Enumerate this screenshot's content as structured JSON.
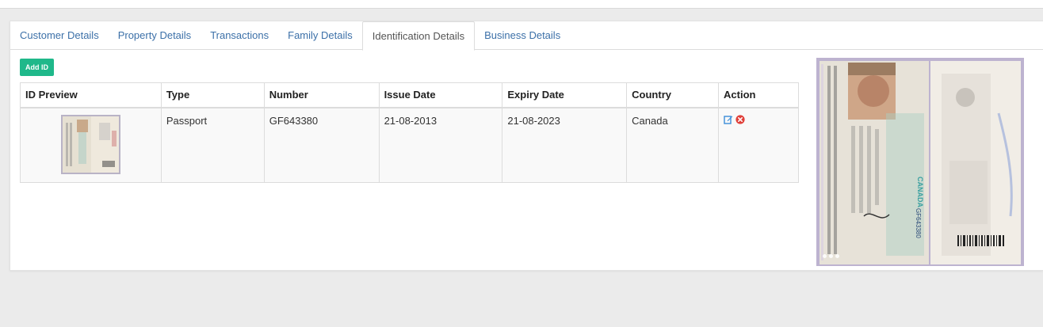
{
  "tabs": [
    {
      "label": "Customer Details"
    },
    {
      "label": "Property Details"
    },
    {
      "label": "Transactions"
    },
    {
      "label": "Family Details"
    },
    {
      "label": "Identification Details"
    },
    {
      "label": "Business Details"
    }
  ],
  "active_tab": "Identification Details",
  "add_button_label": "Add ID",
  "table": {
    "headers": [
      "ID Preview",
      "Type",
      "Number",
      "Issue Date",
      "Expiry Date",
      "Country",
      "Action"
    ],
    "rows": [
      {
        "type": "Passport",
        "number": "GF643380",
        "issue_date": "21-08-2013",
        "expiry_date": "21-08-2023",
        "country": "Canada"
      }
    ]
  },
  "preview": {
    "passport_number_text": "GF643380",
    "country_text": "CANADA"
  },
  "colors": {
    "link": "#3c70a8",
    "accent_button": "#1fb88a",
    "edit_icon": "#3c8dd8",
    "delete_icon": "#e0403a"
  },
  "icons": [
    "edit-icon",
    "delete-icon"
  ]
}
